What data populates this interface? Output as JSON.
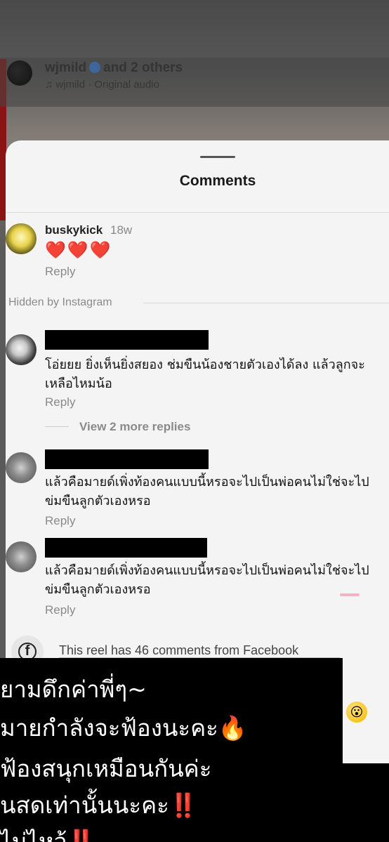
{
  "reel": {
    "username": "wjmild",
    "and_others": "and 2 others",
    "audio": "wjmild · Original audio"
  },
  "sheet": {
    "title": "Comments"
  },
  "comments": [
    {
      "username": "buskykick",
      "time": "18w",
      "text": "❤️❤️❤️",
      "reply": "Reply"
    },
    {
      "username": "",
      "text": "โอ่ยยย ยิ่งเห็นยิ่งสยอง ช่มขืนน้องชายตัวเองได้ลง แล้วลูกจะเหลือไหมน้อ",
      "reply": "Reply",
      "view_more": "View 2 more replies"
    },
    {
      "username": "",
      "text": "แล้วคือมายด์เพิ่งท้องคนแบบนี้หรอจะไปเป็นพ่อคนไม่ใช่จะไปข่มขืนลูกตัวเองหรอ",
      "reply": "Reply"
    },
    {
      "username": "",
      "text": "แล้วคือมายด์เพิ่งท้องคนแบบนี้หรอจะไปเป็นพ่อคนไม่ใช่จะไปข่มขืนลูกตัวเองหรอ",
      "reply": "Reply"
    }
  ],
  "hidden_label": "Hidden by Instagram",
  "facebook_note": "This reel has 46 comments from Facebook",
  "emoji": "😮",
  "story_overlay": {
    "line1": "ยามดึกค่าพี่ๆ~",
    "line2": "มายกำลังจะฟ้องนะคะ",
    "line2_emoji": "🔥",
    "line3": "ฟ้องสนุกเหมือนกันค่ะ",
    "line4": "นสดเท่านั้นนะคะ",
    "line4_mark": "‼️",
    "line5": "ไม่ไหว้",
    "line5_mark": "‼️"
  },
  "colors": {
    "heart": "#e0263a",
    "verified": "#3b6fb6",
    "exclamation": "#ff2a2a"
  }
}
